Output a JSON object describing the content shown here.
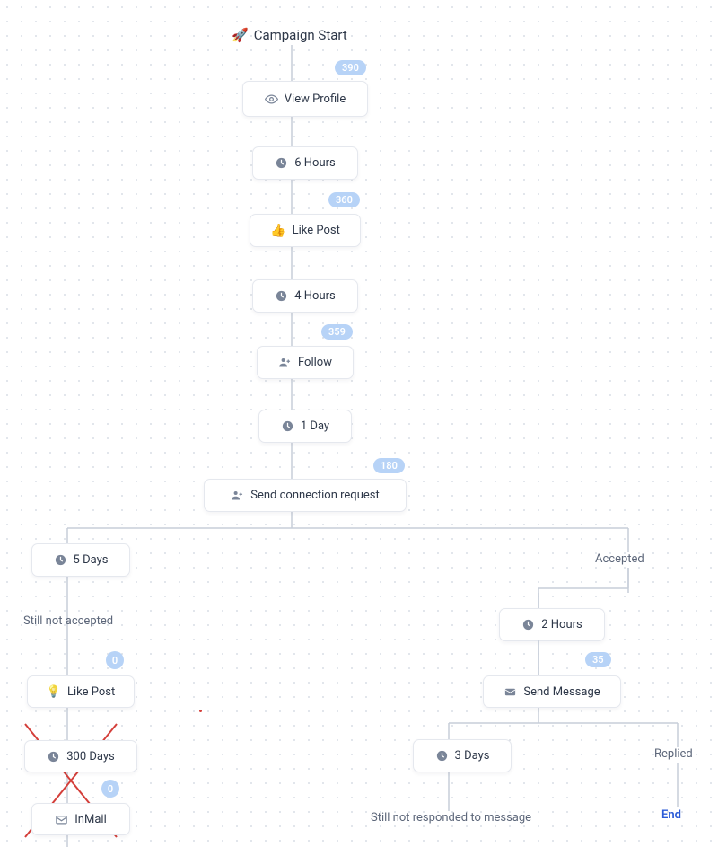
{
  "title": "Campaign Start",
  "nodes": {
    "view_profile": {
      "label": "View Profile",
      "badge": "390"
    },
    "wait_6h": {
      "label": "6 Hours"
    },
    "like_post_1": {
      "label": "Like Post",
      "badge": "360"
    },
    "wait_4h": {
      "label": "4 Hours"
    },
    "follow": {
      "label": "Follow",
      "badge": "359"
    },
    "wait_1d": {
      "label": "1 Day"
    },
    "send_conn": {
      "label": "Send connection request",
      "badge": "180"
    },
    "wait_5d": {
      "label": "5 Days"
    },
    "still_not_accepted": {
      "label": "Still not accepted"
    },
    "like_post_2": {
      "label": "Like Post",
      "badge": "0"
    },
    "wait_300d": {
      "label": "300 Days"
    },
    "inmail": {
      "label": "InMail",
      "badge": "0"
    },
    "accepted": {
      "label": "Accepted"
    },
    "wait_2h": {
      "label": "2 Hours"
    },
    "send_msg": {
      "label": "Send Message",
      "badge": "35"
    },
    "wait_3d": {
      "label": "3 Days"
    },
    "still_not_responded": {
      "label": "Still not responded to message"
    },
    "replied": {
      "label": "Replied"
    },
    "end": {
      "label": "End"
    }
  },
  "icons": {
    "rocket": "🚀",
    "thumb": "👍",
    "bulb": "💡"
  }
}
